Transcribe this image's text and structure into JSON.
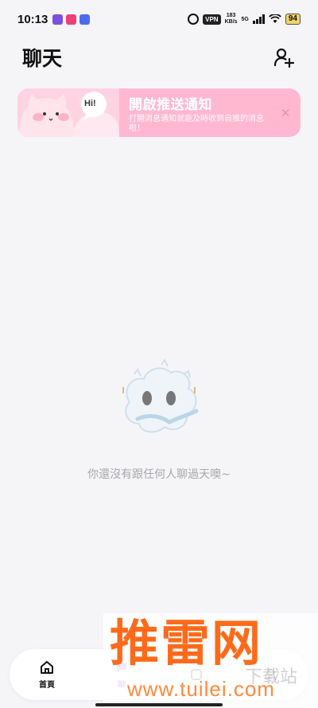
{
  "status_bar": {
    "time": "10:13",
    "vpn": "VPN",
    "speed_value": "183",
    "speed_unit": "KB/s",
    "network": "5G",
    "battery": "94"
  },
  "header": {
    "title": "聊天",
    "add_friend_icon": "add-person-icon"
  },
  "push_banner": {
    "art_bubble": "Hi!",
    "title": "開啟推送通知",
    "description": "打開消息通知就能及時收到自推的消息啦！",
    "close": "✕"
  },
  "empty_state": {
    "message": "你還沒有跟任何人聊過天噢~"
  },
  "bottom_nav": {
    "items": [
      {
        "label": "首頁",
        "icon": "home-icon"
      },
      {
        "label": "聊",
        "icon": "chat-icon"
      },
      {
        "label": "",
        "icon": "square-icon"
      },
      {
        "label": "",
        "icon": "profile-icon"
      }
    ]
  },
  "watermark": {
    "brand": "推雷网",
    "url": "www.tuilei.com",
    "faded": "下载站"
  },
  "colors": {
    "background": "#f5f5f7",
    "banner": "#ffb8cf",
    "accent_orange": "#ff6a1a",
    "accent_purple": "#8e5dd8"
  }
}
